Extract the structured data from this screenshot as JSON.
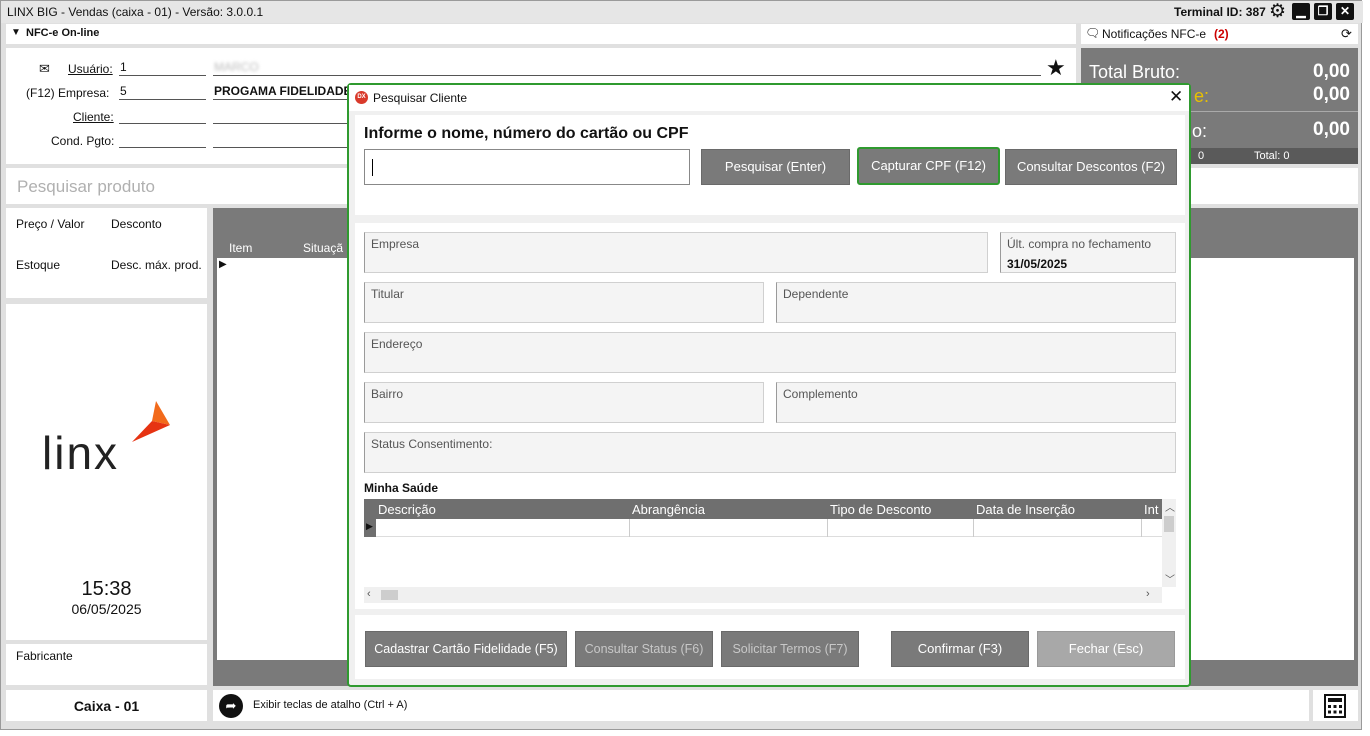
{
  "window": {
    "title": "LINX BIG - Vendas (caixa - 01) - Versão: 3.0.0.1",
    "terminal": "Terminal ID: 387"
  },
  "nfce": {
    "mode": "NFC-e On-line",
    "notifications_label": "Notificações NFC-e",
    "notifications_count": "(2)"
  },
  "form": {
    "usuario_label": "Usuário:",
    "usuario_value": "1",
    "usuario_name": "MARCO",
    "empresa_label": "(F12) Empresa:",
    "empresa_value": "5",
    "empresa_name": "PROGAMA FIDELIDADE",
    "cliente_label": "Cliente:",
    "cond_label": "Cond. Pgto:"
  },
  "totals": {
    "bruto_label": "Total Bruto:",
    "bruto_value": "0,00",
    "row2_label": "e:",
    "row2_value": "0,00",
    "row3_label": "o:",
    "row3_value": "0,00",
    "count_left": "0",
    "total_count": "Total: 0"
  },
  "search_product_placeholder": "Pesquisar produto",
  "left": {
    "preco": "Preço / Valor",
    "desconto": "Desconto",
    "estoque": "Estoque",
    "desc_max": "Desc. máx. prod.",
    "logo_text": "linx",
    "time": "15:38",
    "date": "06/05/2025",
    "fabricante": "Fabricante"
  },
  "items_grid": {
    "col_item": "Item",
    "col_situacao": "Situaçã"
  },
  "bottom": {
    "caixa": "Caixa - 01",
    "shortcut": "Exibir teclas de atalho (Ctrl + A)"
  },
  "dialog": {
    "title": "Pesquisar Cliente",
    "prompt": "Informe o nome, número do cartão ou CPF",
    "search_value": "",
    "btn_search": "Pesquisar (Enter)",
    "btn_capture": "Capturar CPF (F12)",
    "btn_discounts": "Consultar Descontos (F2)",
    "f_empresa": "Empresa",
    "f_ult_compra": "Últ. compra no fechamento",
    "f_ult_compra_value": "31/05/2025",
    "f_titular": "Titular",
    "f_dependente": "Dependente",
    "f_endereco": "Endereço",
    "f_bairro": "Bairro",
    "f_complemento": "Complemento",
    "f_status": "Status Consentimento:",
    "section": "Minha Saúde",
    "grid_cols": [
      "Descrição",
      "Abrangência",
      "Tipo de Desconto",
      "Data de Inserção",
      "Int"
    ],
    "btn_cadastrar": "Cadastrar Cartão Fidelidade (F5)",
    "btn_status": "Consultar Status (F6)",
    "btn_termos": "Solicitar Termos (F7)",
    "btn_confirmar": "Confirmar (F3)",
    "btn_fechar": "Fechar (Esc)"
  },
  "colors": {
    "dialog_border": "#2f9a2f",
    "button_gray": "#7a7a7a",
    "notification_red": "#cc0000",
    "totals_yellow": "#e8c000"
  }
}
